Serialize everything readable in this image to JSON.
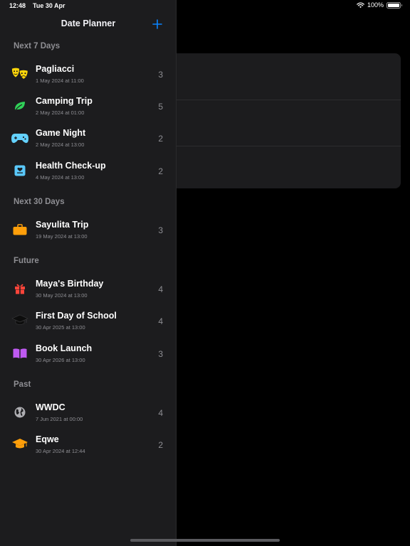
{
  "status": {
    "time": "12:48",
    "date": "Tue 30 Apr",
    "battery": "100%"
  },
  "nav": {
    "title": "Date Planner",
    "add_icon": "plus-icon"
  },
  "sections": [
    {
      "title": "Next 7 Days",
      "items": [
        {
          "title": "Pagliacci",
          "date": "1 May 2024 at 11:00",
          "count": "3",
          "icon": "theater-masks-icon",
          "color": "#ffd60a"
        },
        {
          "title": "Camping Trip",
          "date": "2 May 2024 at 01:00",
          "count": "5",
          "icon": "leaf-icon",
          "color": "#30d158"
        },
        {
          "title": "Game Night",
          "date": "2 May 2024 at 13:00",
          "count": "2",
          "icon": "gamecontroller-icon",
          "color": "#64d2ff"
        },
        {
          "title": "Health Check-up",
          "date": "4 May 2024 at 13:00",
          "count": "2",
          "icon": "medical-card-icon",
          "color": "#5ac8fa"
        }
      ]
    },
    {
      "title": "Next 30 Days",
      "items": [
        {
          "title": "Sayulita Trip",
          "date": "19 May 2024 at 13:00",
          "count": "3",
          "icon": "suitcase-icon",
          "color": "#ff9f0a"
        }
      ]
    },
    {
      "title": "Future",
      "items": [
        {
          "title": "Maya's Birthday",
          "date": "30 May 2024 at 13:00",
          "count": "4",
          "icon": "gift-icon",
          "color": "#ff453a"
        },
        {
          "title": "First Day of School",
          "date": "30 Apr 2025 at 13:00",
          "count": "4",
          "icon": "graduation-cap-icon",
          "color": "#111111"
        },
        {
          "title": "Book Launch",
          "date": "30 Apr 2026 at 13:00",
          "count": "3",
          "icon": "book-icon",
          "color": "#bf5af2"
        }
      ]
    },
    {
      "title": "Past",
      "items": [
        {
          "title": "WWDC",
          "date": "7 Jun 2021 at 00:00",
          "count": "4",
          "icon": "globe-icon",
          "color": "#aeaeb2"
        },
        {
          "title": "Eqwe",
          "date": "30 Apr 2024 at 12:44",
          "count": "2",
          "icon": "graduation-cap-icon",
          "color": "#ff9f0a"
        }
      ]
    }
  ],
  "colors": {
    "accent": "#0a84ff",
    "sidebar_bg": "#1c1c1e",
    "secondary_text": "#8e8e93"
  }
}
